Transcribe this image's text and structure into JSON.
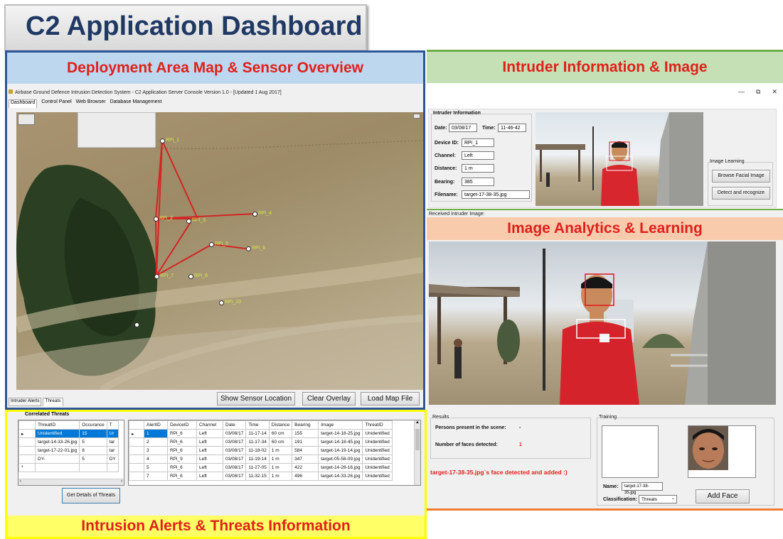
{
  "dashboard_title": "C2 Application Dashboard",
  "panels": {
    "map": "Deployment Area Map & Sensor Overview",
    "intruder": "Intruder Information & Image",
    "analytics": "Image Analytics & Learning",
    "alerts": "Intrusion Alerts & Threats Information"
  },
  "colors": {
    "title": "#1f3864",
    "panel_title": "#e0201b",
    "map_border": "#2f5597",
    "intruder_border": "#70ad47",
    "analytics_border": "#ed7d31",
    "alerts_border": "#ffff00"
  },
  "app": {
    "window_title": "Airbase Ground Defence Intrusion Detection System - C2 Application Server Console Version 1.0 - [Updated 1 Aug 2017]",
    "tabs": [
      "Dashboard",
      "Control Panel",
      "Web Browser",
      "Database Management"
    ],
    "bottom_tabs": [
      "Intruder Alerts",
      "Threats"
    ],
    "buttons": {
      "show_sensor": "Show Sensor Location",
      "clear_overlay": "Clear Overlay",
      "load_map": "Load Map File"
    },
    "window_controls": [
      "—",
      "⧉",
      "✕"
    ]
  },
  "sensors": [
    {
      "label": "RPi_1"
    },
    {
      "label": "RPi_2"
    },
    {
      "label": "RPi_3"
    },
    {
      "label": "RPi_4"
    },
    {
      "label": "RPi_5"
    },
    {
      "label": "RPi_6"
    },
    {
      "label": "RPi_7"
    },
    {
      "label": "RPi_8"
    },
    {
      "label": "RPi_10"
    }
  ],
  "intruder_info": {
    "group_title": "Intruder Information",
    "date_label": "Date:",
    "date": "03/08/17",
    "time_label": "Time:",
    "time": "11-46-42",
    "device_label": "Device ID:",
    "device": "RPi_1",
    "channel_label": "Channel:",
    "channel": "Left",
    "distance_label": "Distance:",
    "distance": "1 m",
    "bearing_label": "Bearing:",
    "bearing": "385",
    "filename_label": "Filename:",
    "filename": "target-17-38-35.jpg"
  },
  "image_learning": {
    "group_title": "Image Learning",
    "browse": "Browse Facial Image",
    "detect": "Detect and recognize"
  },
  "received_label": "Received Intruder Image:",
  "results": {
    "group_title": "Results",
    "persons_label": "Persons present in the scene:",
    "persons_value": "-",
    "faces_label": "Number of faces detected:",
    "faces_value": "1",
    "message": "target-17-38-35.jpg`s face detected and added :)"
  },
  "training": {
    "group_title": "Training",
    "name_label": "Name:",
    "name_value": "target-17-38-35.jpg",
    "class_label": "Classification:",
    "class_value": "Threats",
    "add_face": "Add Face"
  },
  "correlated": {
    "title": "Correlated Threats",
    "columns": [
      "ThreatID",
      "Occurance",
      "T"
    ],
    "rows": [
      [
        "Unidentified",
        "15",
        "Ur"
      ],
      [
        "target-14-33-26.jpg",
        "5",
        "tar"
      ],
      [
        "target-17-22-01.jpg",
        "8",
        "tar"
      ],
      [
        "DY-",
        "5",
        "DY"
      ]
    ],
    "button": "Get Details of Threats"
  },
  "alerts": {
    "columns": [
      "AlertID",
      "DeviceID",
      "Channel",
      "Date",
      "Time",
      "Distance",
      "Bearing",
      "Image",
      "ThreatID"
    ],
    "rows": [
      [
        "1",
        "RPi_6",
        "Left",
        "03/08/17",
        "11-17-14",
        "60 cm",
        "155",
        "target-14-18-25.jpg",
        "Unidentified"
      ],
      [
        "2",
        "RPi_6",
        "Left",
        "03/08/17",
        "11-17-34",
        "60 cm",
        "191",
        "target-14-18-45.jpg",
        "Unidentified"
      ],
      [
        "3",
        "RPi_6",
        "Left",
        "03/08/17",
        "11-18-02",
        "1 m",
        "584",
        "target-14-19-14.jpg",
        "Unidentified"
      ],
      [
        "4",
        "RPi_9",
        "Left",
        "03/08/17",
        "11-19-14",
        "1 m",
        "347",
        "target-05-58-09.jpg",
        "Unidentified"
      ],
      [
        "5",
        "RPi_6",
        "Left",
        "03/08/17",
        "11-27-05",
        "1 m",
        "422",
        "target-14-28-16.jpg",
        "Unidentified"
      ],
      [
        "7",
        "RPi_6",
        "Left",
        "03/08/17",
        "11-32-15",
        "1 m",
        "496",
        "target-14-33-26.jpg",
        "Unidentified"
      ]
    ]
  }
}
